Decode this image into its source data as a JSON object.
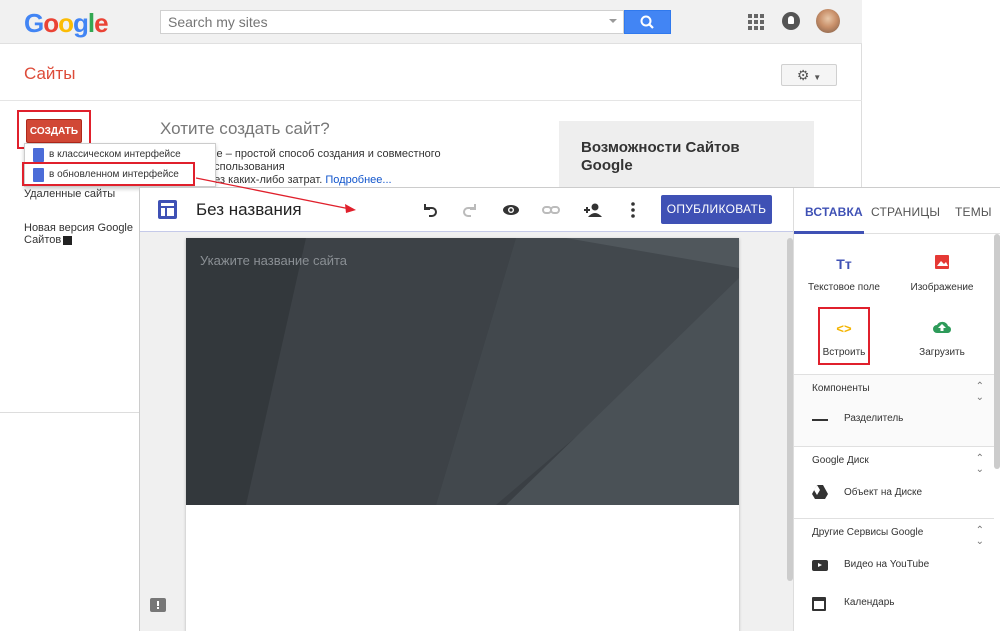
{
  "classic": {
    "logo": [
      "G",
      "o",
      "o",
      "g",
      "l",
      "e"
    ],
    "search": {
      "placeholder": "Search my sites"
    },
    "title": "Сайты",
    "create_label": "СОЗДАТЬ",
    "dropdown": [
      "в классическом интерфейсе",
      "в обновленном интерфейсе"
    ],
    "deleted_sites": "Удаленные сайты",
    "new_version": "Новая версия Google Сайтов",
    "want_title": "Хотите создать сайт?",
    "desc_line1": "gle – простой способ создания и совместного использования",
    "desc_line2": "без каких-либо затрат.",
    "desc_link": "Подробнее...",
    "promo_title": "Возможности Сайтов Google"
  },
  "editor": {
    "site_name": "Без названия",
    "publish_label": "ОПУБЛИКОВАТЬ",
    "hero_placeholder": "Укажите название сайта"
  },
  "sidebar": {
    "tabs": [
      "ВСТАВКА",
      "СТРАНИЦЫ",
      "ТЕМЫ"
    ],
    "insert_items": [
      "Текстовое поле",
      "Изображение",
      "Встроить",
      "Загрузить"
    ],
    "sections": [
      {
        "title": "Компоненты",
        "item": "Разделитель"
      },
      {
        "title": "Google Диск",
        "item": "Объект на Диске"
      },
      {
        "title": "Другие Сервисы Google",
        "item": "Видео на YouTube"
      }
    ],
    "extra_item": "Календарь"
  },
  "colors": {
    "accent": "#3f51b5",
    "create": "#d14836",
    "highlight": "#e0202c",
    "sites_red": "#dd4b39"
  }
}
